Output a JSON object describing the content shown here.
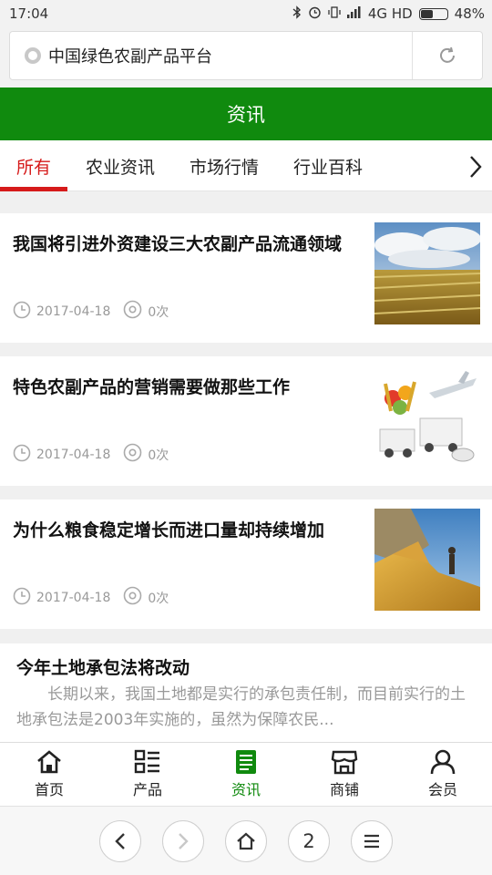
{
  "status_bar": {
    "time": "17:04",
    "network": "4G HD",
    "battery": "48%",
    "battery_level": 0.48,
    "icons": [
      "bluetooth-icon",
      "alarm-icon",
      "vibrate-icon",
      "signal-icon",
      "battery-icon"
    ]
  },
  "url_bar": {
    "title": "中国绿色农副产品平台",
    "icons": [
      "globe-icon",
      "refresh-icon"
    ]
  },
  "header": {
    "title": "资讯"
  },
  "tabs": {
    "items": [
      "所有",
      "农业资讯",
      "市场行情",
      "行业百科"
    ],
    "active_index": 0,
    "active_color": "#d61a1a"
  },
  "news": [
    {
      "title": "我国将引进外资建设三大农副产品流通领域",
      "date": "2017-04-18",
      "views": "0次",
      "image": "wheat-field-photo"
    },
    {
      "title": "特色农副产品的营销需要做那些工作",
      "date": "2017-04-18",
      "views": "0次",
      "image": "logistics-produce-illustration"
    },
    {
      "title": "为什么粮食稳定增长而进口量却持续增加",
      "date": "2017-04-18",
      "views": "0次",
      "image": "grain-pile-photo"
    }
  ],
  "article": {
    "title": "今年土地承包法将改动",
    "excerpt": "长期以来，我国土地都是实行的承包责任制，而目前实行的土地承包法是2003年实施的，虽然为保障农民..."
  },
  "bottom_nav": {
    "items": [
      {
        "label": "首页",
        "icon": "home-icon"
      },
      {
        "label": "产品",
        "icon": "list-icon"
      },
      {
        "label": "资讯",
        "icon": "news-icon"
      },
      {
        "label": "商铺",
        "icon": "store-icon"
      },
      {
        "label": "会员",
        "icon": "user-icon"
      }
    ],
    "active_index": 2
  },
  "browser_bar": {
    "tab_count": "2",
    "icons": [
      "back-icon",
      "forward-icon",
      "home-icon",
      "tabs-icon",
      "menu-icon"
    ]
  },
  "colors": {
    "brand_green": "#108a0e",
    "accent_red": "#d61a1a",
    "meta_gray": "#999999"
  }
}
